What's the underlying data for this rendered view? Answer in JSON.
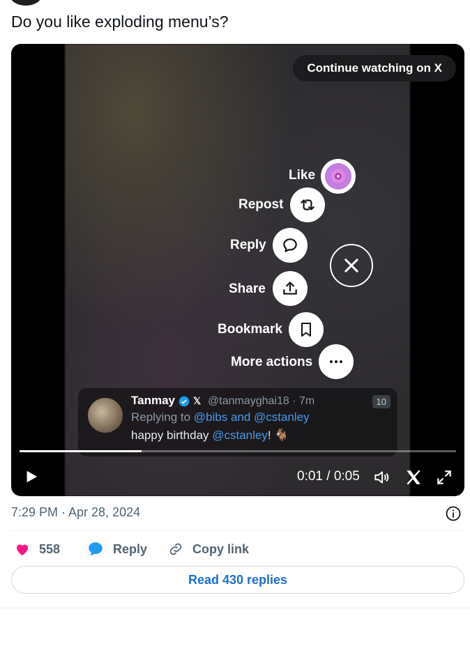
{
  "tweet": {
    "text": "Do you like exploding menu’s?",
    "timestamp": "7:29 PM · Apr 28, 2024"
  },
  "video": {
    "continue_label": "Continue watching on X",
    "menu": {
      "like": "Like",
      "repost": "Repost",
      "reply": "Reply",
      "share": "Share",
      "bookmark": "Bookmark",
      "more": "More actions"
    },
    "reply_card": {
      "name": "Tanmay",
      "handle_time": "@tanmayghai18 · 7m",
      "replying_prefix": "Replying to ",
      "replying_targets": "@bibs and @cstanley",
      "text_prefix": "happy birthday ",
      "mention": "@cstanley",
      "text_suffix": "! 🐐",
      "badge": "10"
    },
    "time_display": "0:01 / 0:05",
    "progress": 0.28
  },
  "actions": {
    "likes": "558",
    "reply": "Reply",
    "copy_link": "Copy link",
    "read_replies": "Read 430 replies"
  },
  "colors": {
    "like_heart": "#f91880",
    "reply_bubble": "#1d9bf0",
    "link": "#1d6fd1"
  }
}
